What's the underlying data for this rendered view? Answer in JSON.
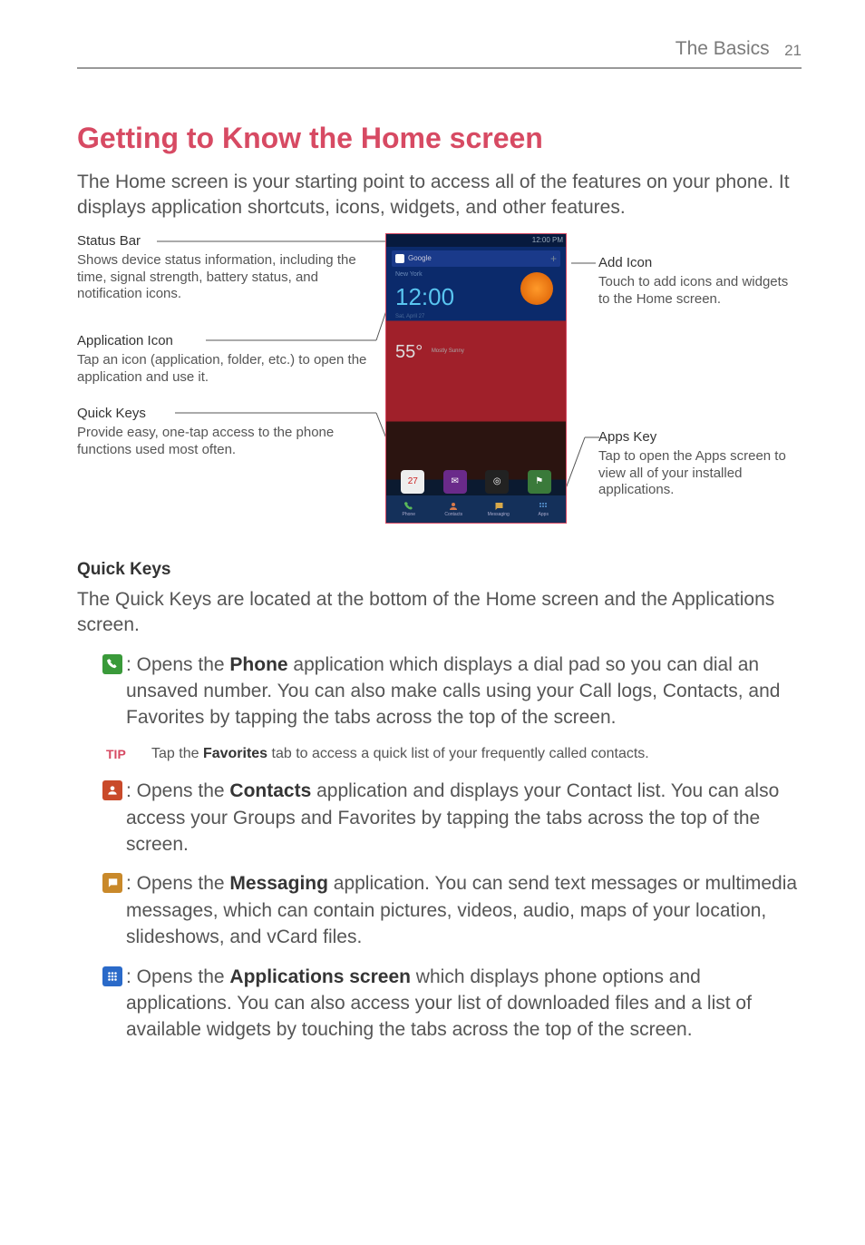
{
  "header": {
    "section": "The Basics",
    "page": "21"
  },
  "title": "Getting to Know the Home screen",
  "intro": "The Home screen is your starting point to access all of the features on your phone. It displays application shortcuts, icons, widgets, and other features.",
  "labels": {
    "status_bar": {
      "title": "Status Bar",
      "desc": "Shows device status information, including the time, signal strength, battery status, and notification icons."
    },
    "app_icon": {
      "title": "Application Icon",
      "desc": "Tap an icon (application, folder, etc.) to open the application and use it."
    },
    "quick_keys_lbl": {
      "title": "Quick Keys",
      "desc": "Provide easy, one-tap access to the phone functions used most often."
    },
    "add_icon": {
      "title": "Add Icon",
      "desc": "Touch to add icons and widgets to the Home screen."
    },
    "apps_key": {
      "title": "Apps Key",
      "desc": "Tap to open the Apps screen to view all of your installed applications."
    }
  },
  "mock": {
    "status_time": "12:00 PM",
    "search": "Google",
    "city": "New York",
    "clock": "12:00",
    "date": "Sat, April 27",
    "temp": "55°",
    "weather": "Mostly Sunny",
    "cal_num": "27",
    "dock": {
      "phone": "Phone",
      "contacts": "Contacts",
      "messaging": "Messaging",
      "apps": "Apps"
    }
  },
  "quick_keys": {
    "heading": "Quick Keys",
    "intro": "The Quick Keys are located at the bottom of the Home screen and the Applications screen.",
    "items": [
      {
        "icon": "phone-icon",
        "color": "#3a9a3a",
        "bold": "Phone",
        "pre": ": Opens the ",
        "post": " application which displays a dial pad so you can dial an unsaved number. You can also make calls using your Call logs, Contacts, and Favorites by tapping the tabs across the top of the screen."
      },
      {
        "icon": "contacts-icon",
        "color": "#c94a2a",
        "bold": "Contacts",
        "pre": ": Opens the ",
        "post": " application and displays your Contact list. You can also access your Groups and Favorites by tapping the tabs across the top of the screen."
      },
      {
        "icon": "messaging-icon",
        "color": "#c9892a",
        "bold": "Messaging",
        "pre": ": Opens the ",
        "post": " application. You can send text messages or multimedia messages, which can contain pictures, videos, audio, maps of your location, slideshows, and vCard files."
      },
      {
        "icon": "apps-icon",
        "color": "#2a6ac9",
        "bold": "Applications screen",
        "pre": ": Opens the ",
        "post": " which displays phone options and applications. You can also access your list of downloaded files and a list of available widgets by touching the tabs across the top of the screen."
      }
    ],
    "tip": {
      "label": "TIP",
      "bold": "Favorites",
      "pre": "Tap the ",
      "post": " tab to access a quick list of your frequently called contacts."
    }
  }
}
